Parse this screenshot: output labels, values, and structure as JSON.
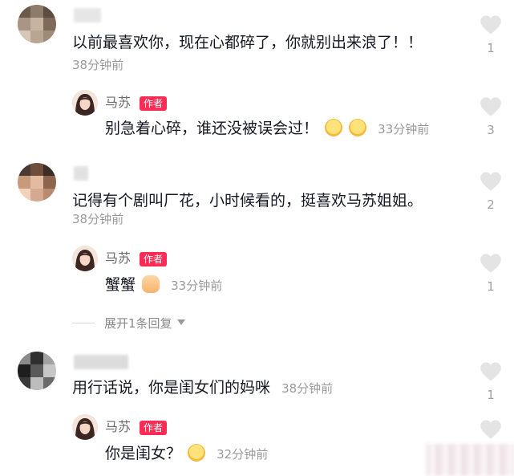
{
  "comments": [
    {
      "text": "以前最喜欢你，现在心都碎了，你就别出来浪了！！",
      "time": "38分钟前",
      "likes": "1",
      "reply": {
        "author": "马苏",
        "badge": "作者",
        "text": "别急着心碎，谁还没被误会过！",
        "time": "33分钟前",
        "likes": "3"
      }
    },
    {
      "text": "记得有个剧叫厂花，小时候看的，挺喜欢马苏姐姐。",
      "time": "38分钟前",
      "likes": "2",
      "reply": {
        "author": "马苏",
        "badge": "作者",
        "text": "蟹蟹",
        "time": "33分钟前",
        "likes": "1"
      },
      "expand_label": "展开1条回复"
    },
    {
      "text": "用行话说，你是闺女们的妈咪",
      "time": "38分钟前",
      "likes": "1",
      "reply": {
        "author": "马苏",
        "badge": "作者",
        "text": "你是闺女？",
        "time": "32分钟前",
        "likes": ""
      }
    }
  ],
  "icons": {
    "like": "heart-icon",
    "expand": "chevron-down-icon",
    "emoji_1": "dizzy-face-emoji",
    "emoji_2": "astonished-face-emoji",
    "emoji_3": "ok-hand-emoji",
    "emoji_4": "rofl-emoji"
  },
  "colors": {
    "badge": "#fe2c55",
    "heart": "#e4e4e4",
    "meta_text": "#9a9a9a"
  }
}
